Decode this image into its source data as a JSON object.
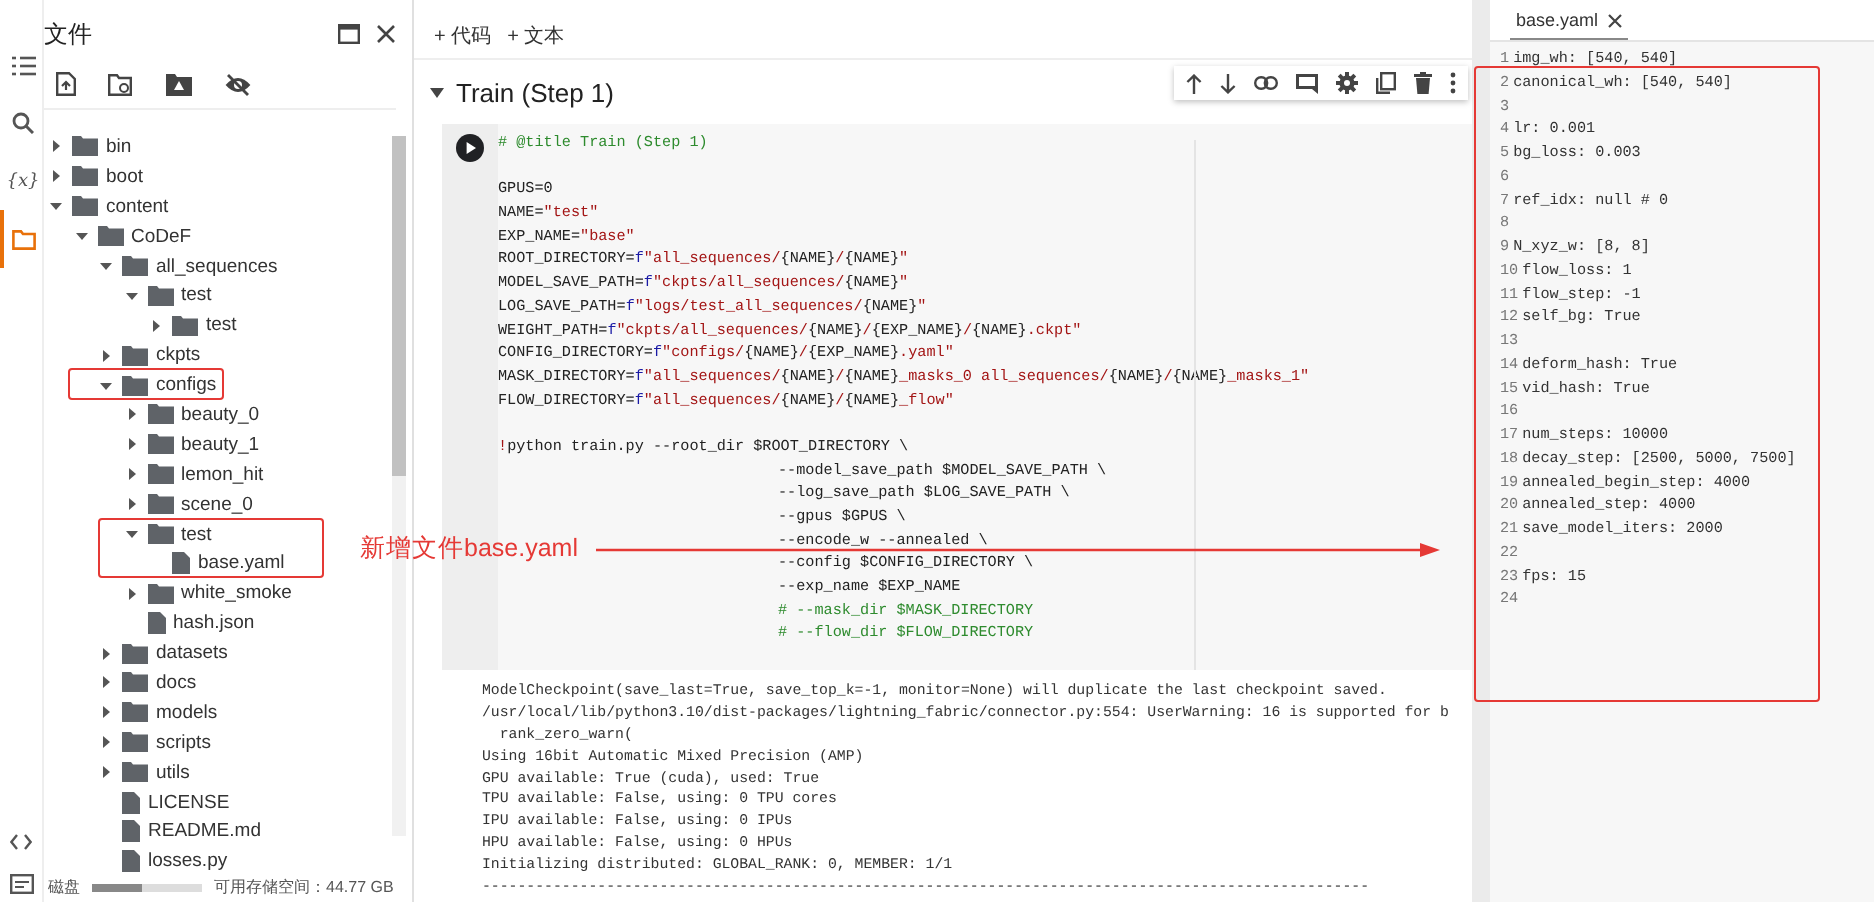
{
  "rail": {
    "top": [
      {
        "kind": "toc",
        "selected": false
      },
      {
        "kind": "search",
        "selected": false
      },
      {
        "kind": "variables",
        "label": "{x}",
        "selected": false
      },
      {
        "kind": "files",
        "selected": true
      }
    ],
    "bottom": [
      {
        "kind": "code"
      },
      {
        "kind": "terminal"
      }
    ]
  },
  "files": {
    "title": "文件",
    "tree": [
      {
        "name": "bin",
        "kind": "folder",
        "expanded": false
      },
      {
        "name": "boot",
        "kind": "folder",
        "expanded": false
      },
      {
        "name": "content",
        "kind": "folder",
        "expanded": true,
        "children": [
          {
            "name": "CoDeF",
            "kind": "folder",
            "expanded": true,
            "children": [
              {
                "name": "all_sequences",
                "kind": "folder",
                "expanded": true,
                "children": [
                  {
                    "name": "test",
                    "kind": "folder",
                    "expanded": true,
                    "children": [
                      {
                        "name": "test",
                        "kind": "folder",
                        "expanded": false
                      }
                    ]
                  }
                ]
              },
              {
                "name": "ckpts",
                "kind": "folder",
                "expanded": false
              },
              {
                "name": "configs",
                "kind": "folder",
                "expanded": true,
                "children": [
                  {
                    "name": "beauty_0",
                    "kind": "folder",
                    "expanded": false
                  },
                  {
                    "name": "beauty_1",
                    "kind": "folder",
                    "expanded": false
                  },
                  {
                    "name": "lemon_hit",
                    "kind": "folder",
                    "expanded": false
                  },
                  {
                    "name": "scene_0",
                    "kind": "folder",
                    "expanded": false
                  },
                  {
                    "name": "test",
                    "kind": "folder",
                    "expanded": true,
                    "children": [
                      {
                        "name": "base.yaml",
                        "kind": "file"
                      }
                    ]
                  },
                  {
                    "name": "white_smoke",
                    "kind": "folder",
                    "expanded": false
                  },
                  {
                    "name": "hash.json",
                    "kind": "file"
                  }
                ]
              },
              {
                "name": "datasets",
                "kind": "folder",
                "expanded": false
              },
              {
                "name": "docs",
                "kind": "folder",
                "expanded": false
              },
              {
                "name": "models",
                "kind": "folder",
                "expanded": false
              },
              {
                "name": "scripts",
                "kind": "folder",
                "expanded": false
              },
              {
                "name": "utils",
                "kind": "folder",
                "expanded": false
              },
              {
                "name": "LICENSE",
                "kind": "file"
              },
              {
                "name": "README.md",
                "kind": "file"
              },
              {
                "name": "losses.py",
                "kind": "file"
              }
            ]
          }
        ]
      }
    ],
    "disk_label": "磁盘",
    "disk": {
      "level": 0.45
    },
    "storage": "可用存储空间：44.77 GB"
  },
  "toolbar": [
    "+ 代码",
    "+ 文本"
  ],
  "cell": {
    "title": "Train (Step 1)",
    "code": [
      {
        "kind": "code",
        "segments": [
          {
            "text": "# @title Train (Step 1)",
            "kind": "comment"
          }
        ]
      },
      {
        "kind": "blank"
      },
      {
        "kind": "code",
        "segments": [
          {
            "text": "GPUS=0",
            "kind": "plain"
          }
        ]
      },
      {
        "kind": "code",
        "segments": [
          {
            "text": "NAME=",
            "kind": "plain"
          },
          {
            "text": "\"test\"",
            "kind": "string"
          }
        ]
      },
      {
        "kind": "code",
        "segments": [
          {
            "text": "EXP_NAME=",
            "kind": "plain"
          },
          {
            "text": "\"base\"",
            "kind": "string"
          }
        ]
      },
      {
        "kind": "code",
        "segments": [
          {
            "text": "ROOT_DIRECTORY=",
            "kind": "plain"
          },
          {
            "text": "f",
            "kind": "prefix"
          },
          {
            "text": "\"all_sequences/{NAME}/{NAME}\"",
            "kind": "string"
          }
        ]
      },
      {
        "kind": "code",
        "segments": [
          {
            "text": "MODEL_SAVE_PATH=",
            "kind": "plain"
          },
          {
            "text": "f",
            "kind": "prefix"
          },
          {
            "text": "\"ckpts/all_sequences/{NAME}\"",
            "kind": "string"
          }
        ]
      },
      {
        "kind": "code",
        "segments": [
          {
            "text": "LOG_SAVE_PATH=",
            "kind": "plain"
          },
          {
            "text": "f",
            "kind": "prefix"
          },
          {
            "text": "\"logs/test_all_sequences/{NAME}\"",
            "kind": "string"
          }
        ]
      },
      {
        "kind": "code",
        "segments": [
          {
            "text": "WEIGHT_PATH=",
            "kind": "plain"
          },
          {
            "text": "f",
            "kind": "prefix"
          },
          {
            "text": "\"ckpts/all_sequences/{NAME}/{EXP_NAME}/{NAME}.ckpt\"",
            "kind": "string"
          }
        ]
      },
      {
        "kind": "code",
        "segments": [
          {
            "text": "CONFIG_DIRECTORY=",
            "kind": "plain"
          },
          {
            "text": "f",
            "kind": "prefix"
          },
          {
            "text": "\"configs/{NAME}/{EXP_NAME}.yaml\"",
            "kind": "string"
          }
        ]
      },
      {
        "kind": "code",
        "segments": [
          {
            "text": "MASK_DIRECTORY=",
            "kind": "plain"
          },
          {
            "text": "f",
            "kind": "prefix"
          },
          {
            "text": "\"all_sequences/{NAME}/{NAME}_masks_0 all_sequences/{NAME}/{NAME}_masks_1\"",
            "kind": "string"
          }
        ]
      },
      {
        "kind": "code",
        "segments": [
          {
            "text": "FLOW_DIRECTORY=",
            "kind": "plain"
          },
          {
            "text": "f",
            "kind": "prefix"
          },
          {
            "text": "\"all_sequences/{NAME}/{NAME}_flow\"",
            "kind": "string"
          }
        ]
      },
      {
        "kind": "blank"
      },
      {
        "kind": "code",
        "segments": [
          {
            "text": "!",
            "kind": "string"
          },
          {
            "text": "python train.py --root_dir $ROOT_DIRECTORY \\",
            "kind": "plain"
          }
        ]
      },
      {
        "kind": "continuation",
        "segments": [
          {
            "text": "--model_save_path $MODEL_SAVE_PATH \\",
            "kind": "plain"
          }
        ]
      },
      {
        "kind": "continuation",
        "segments": [
          {
            "text": "--log_save_path $LOG_SAVE_PATH \\",
            "kind": "plain"
          }
        ]
      },
      {
        "kind": "continuation",
        "segments": [
          {
            "text": "--gpus $GPUS \\",
            "kind": "plain"
          }
        ]
      },
      {
        "kind": "continuation",
        "segments": [
          {
            "text": "--encode_w --annealed \\",
            "kind": "plain"
          }
        ]
      },
      {
        "kind": "continuation",
        "segments": [
          {
            "text": "--config $CONFIG_DIRECTORY \\",
            "kind": "plain"
          }
        ]
      },
      {
        "kind": "continuation",
        "segments": [
          {
            "text": "--exp_name $EXP_NAME",
            "kind": "plain"
          }
        ]
      },
      {
        "kind": "continuation",
        "segments": [
          {
            "text": "# --mask_dir $MASK_DIRECTORY",
            "kind": "comment"
          }
        ]
      },
      {
        "kind": "continuation",
        "segments": [
          {
            "text": "# --flow_dir $FLOW_DIRECTORY",
            "kind": "comment"
          }
        ]
      }
    ],
    "output": [
      "ModelCheckpoint(save_last=True, save_top_k=-1, monitor=None) will duplicate the last checkpoint saved.",
      "/usr/local/lib/python3.10/dist-packages/lightning_fabric/connector.py:554: UserWarning: 16 is supported for b",
      "  rank_zero_warn(",
      "Using 16bit Automatic Mixed Precision (AMP)",
      "GPU available: True (cuda), used: True",
      "TPU available: False, using: 0 TPU cores",
      "IPU available: False, using: 0 IPUs",
      "HPU available: False, using: 0 HPUs",
      "Initializing distributed: GLOBAL_RANK: 0, MEMBER: 1/1",
      "----------------------------------------------------------------------------------------------------"
    ]
  },
  "editor": {
    "tab": "base.yaml",
    "lines": [
      {
        "number": "1",
        "text": "img_wh: [540, 540]"
      },
      {
        "number": "2",
        "text": "canonical_wh: [540, 540]"
      },
      {
        "number": "3"
      },
      {
        "number": "4",
        "text": "lr: 0.001"
      },
      {
        "number": "5",
        "text": "bg_loss: 0.003"
      },
      {
        "number": "6"
      },
      {
        "number": "7",
        "text": "ref_idx: null # 0"
      },
      {
        "number": "8"
      },
      {
        "number": "9",
        "text": "N_xyz_w: [8, 8]"
      },
      {
        "number": "10",
        "text": "flow_loss: 1"
      },
      {
        "number": "11",
        "text": "flow_step: -1"
      },
      {
        "number": "12",
        "text": "self_bg: True"
      },
      {
        "number": "13"
      },
      {
        "number": "14",
        "text": "deform_hash: True"
      },
      {
        "number": "15",
        "text": "vid_hash: True"
      },
      {
        "number": "16"
      },
      {
        "number": "17",
        "text": "num_steps: 10000"
      },
      {
        "number": "18",
        "text": "decay_step: [2500, 5000, 7500]"
      },
      {
        "number": "19",
        "text": "annealed_begin_step: 4000"
      },
      {
        "number": "20",
        "text": "annealed_step: 4000"
      },
      {
        "number": "21",
        "text": "save_model_iters: 2000"
      },
      {
        "number": "22"
      },
      {
        "number": "23",
        "text": "fps: 15"
      },
      {
        "number": "24"
      }
    ]
  },
  "annotation": {
    "text": "新增文件base.yaml"
  }
}
